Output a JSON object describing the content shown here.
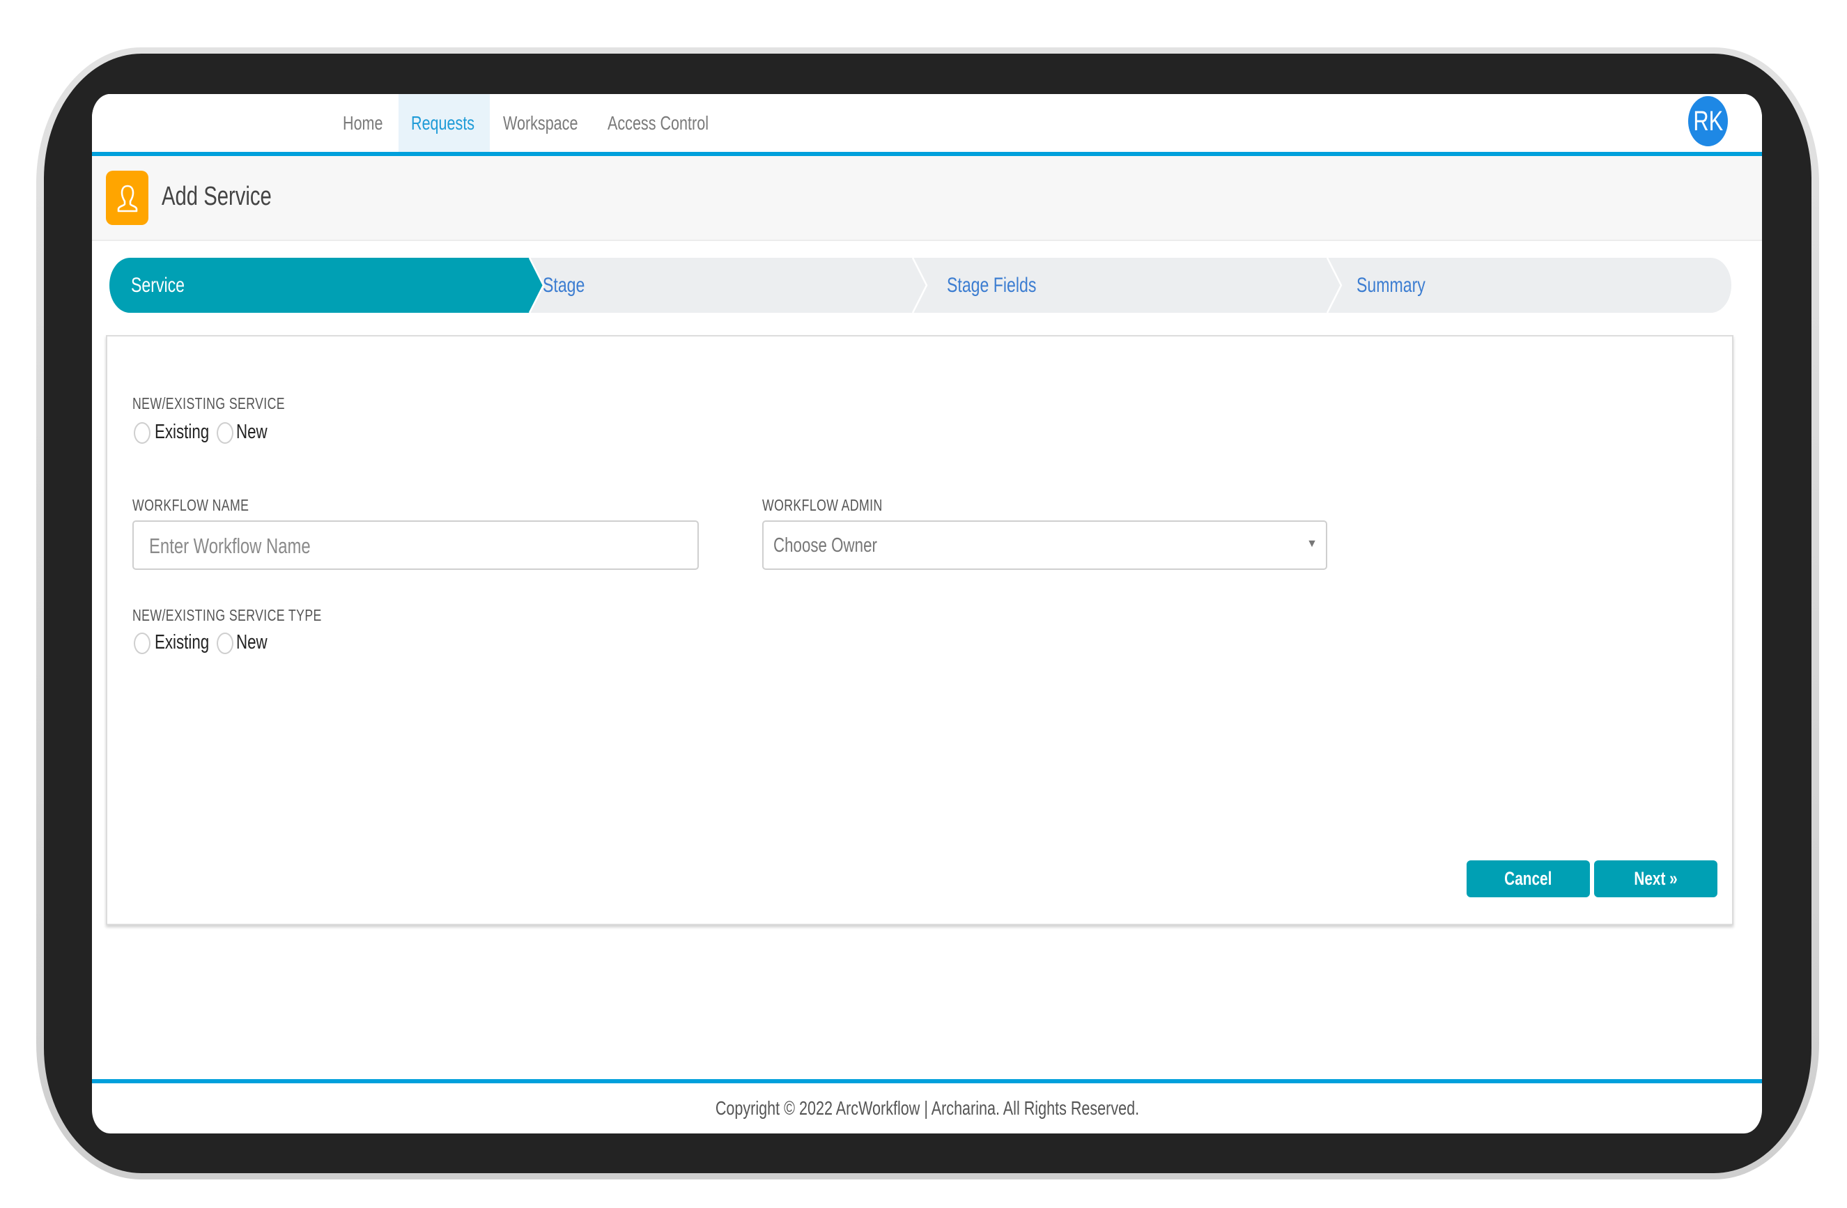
{
  "nav": {
    "items": [
      {
        "label": "Home",
        "active": false
      },
      {
        "label": "Requests",
        "active": true
      },
      {
        "label": "Workspace",
        "active": false
      },
      {
        "label": "Access Control",
        "active": false
      }
    ],
    "avatar_initials": "RK"
  },
  "header": {
    "icon": "user-icon",
    "title": "Add Service"
  },
  "stepper": {
    "steps": [
      {
        "label": "Service",
        "active": true
      },
      {
        "label": "Stage",
        "active": false
      },
      {
        "label": "Stage Fields",
        "active": false
      },
      {
        "label": "Summary",
        "active": false
      }
    ]
  },
  "form": {
    "service_choice": {
      "label": "NEW/EXISTING SERVICE",
      "options": [
        {
          "label": "Existing",
          "checked": false
        },
        {
          "label": "New",
          "checked": false
        }
      ]
    },
    "workflow_name": {
      "label": "WORKFLOW NAME",
      "value": "",
      "placeholder": "Enter Workflow Name"
    },
    "workflow_admin": {
      "label": "WORKFLOW ADMIN",
      "selected": "Choose Owner"
    },
    "service_type_choice": {
      "label": "NEW/EXISTING SERVICE TYPE",
      "options": [
        {
          "label": "Existing",
          "checked": false
        },
        {
          "label": "New",
          "checked": false
        }
      ]
    },
    "buttons": {
      "cancel": "Cancel",
      "next": "Next »"
    }
  },
  "footer": {
    "copyright": "Copyright © 2022 ArcWorkflow | Archarina. All Rights Reserved."
  },
  "colors": {
    "accent_teal": "#00A0B4",
    "nav_line_blue": "#00A0DC",
    "avatar_blue": "#1E88E5",
    "header_icon_orange": "#FFA500",
    "step_text_blue": "#3C7DD1"
  }
}
